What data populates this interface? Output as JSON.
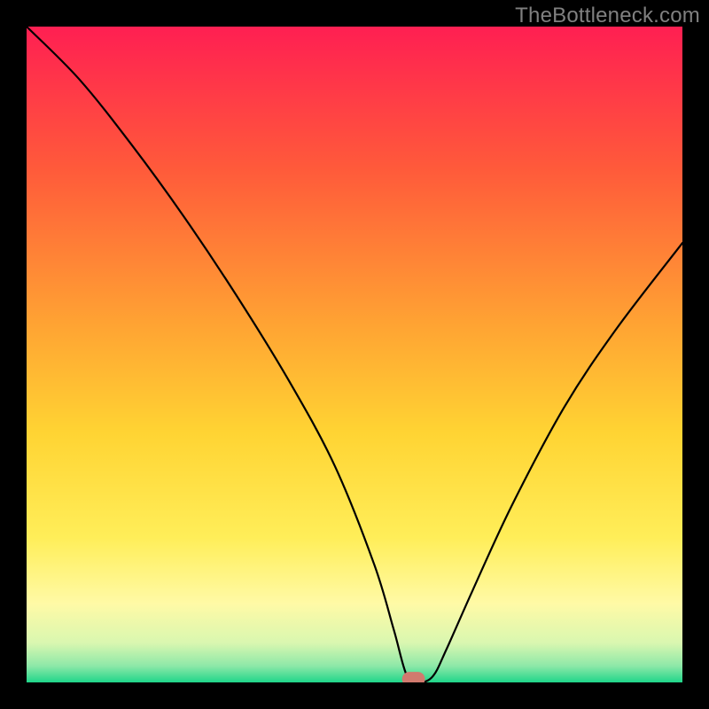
{
  "watermark": {
    "text": "TheBottleneck.com"
  },
  "chart_data": {
    "type": "line",
    "title": "",
    "xlabel": "",
    "ylabel": "",
    "xlim": [
      0,
      100
    ],
    "ylim": [
      0,
      100
    ],
    "grid": false,
    "legend": false,
    "background_gradient": {
      "stops": [
        {
          "offset": 0.0,
          "color": "#ff1f52"
        },
        {
          "offset": 0.22,
          "color": "#ff5b3a"
        },
        {
          "offset": 0.45,
          "color": "#ffa233"
        },
        {
          "offset": 0.62,
          "color": "#ffd433"
        },
        {
          "offset": 0.78,
          "color": "#ffee59"
        },
        {
          "offset": 0.88,
          "color": "#fffaa6"
        },
        {
          "offset": 0.94,
          "color": "#d9f7b0"
        },
        {
          "offset": 0.975,
          "color": "#8de8a8"
        },
        {
          "offset": 1.0,
          "color": "#1fd68a"
        }
      ]
    },
    "series": [
      {
        "name": "bottleneck-curve",
        "x": [
          0,
          8,
          16,
          24,
          32,
          40,
          47,
          53,
          56,
          58,
          60,
          62,
          64,
          68,
          74,
          82,
          90,
          100
        ],
        "values": [
          100,
          92,
          82,
          71,
          59,
          46,
          33,
          18,
          8,
          1,
          0,
          1,
          5,
          14,
          27,
          42,
          54,
          67
        ]
      }
    ],
    "marker": {
      "x": 59,
      "y": 0.5,
      "width": 3.5,
      "height": 2.2,
      "rx": 1.1,
      "color": "#d17a6e"
    },
    "annotations": []
  }
}
